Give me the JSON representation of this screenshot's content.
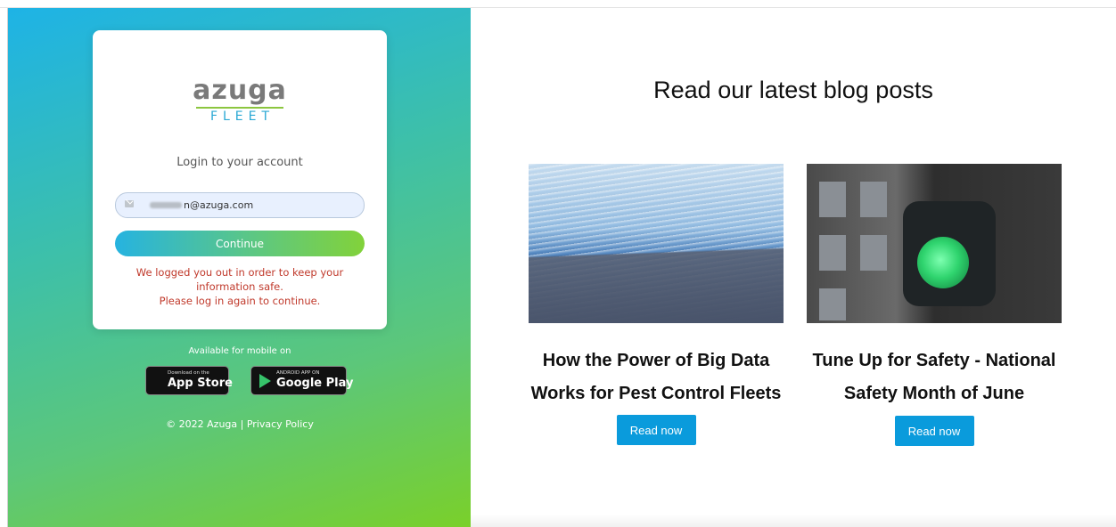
{
  "login": {
    "logo_top": "azuga",
    "logo_bottom": "FLEET",
    "heading": "Login to your account",
    "email_value": "n@azuga.com",
    "continue_label": "Continue",
    "logout_line1": "We logged you out in order to keep your",
    "logout_line2": "information safe.",
    "logout_line3": "Please log in again to continue."
  },
  "mobile": {
    "available_text": "Available for mobile on",
    "appstore_small": "Download on the",
    "appstore_big": "App Store",
    "googleplay_small": "ANDROID APP ON",
    "googleplay_big": "Google Play"
  },
  "footer": {
    "copyright": "© 2022 Azuga",
    "separator": "|",
    "privacy_label": "Privacy Policy"
  },
  "blog": {
    "heading": "Read our latest blog posts",
    "posts": [
      {
        "title": "How the Power of Big Data Works for Pest Control Fleets",
        "button_label": "Read now"
      },
      {
        "title": "Tune Up for Safety - National Safety Month of June",
        "button_label": "Read now"
      }
    ]
  },
  "colors": {
    "gradient_start": "#1eb3e6",
    "gradient_end": "#7ad02a",
    "error_text": "#c0392b",
    "read_button": "#0a9bdc"
  },
  "icons": {
    "email": "mail-icon",
    "appstore": "apple-icon",
    "googleplay": "play-store-icon"
  }
}
